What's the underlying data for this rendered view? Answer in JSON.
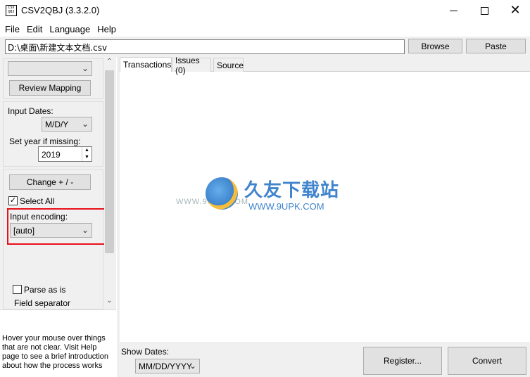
{
  "window": {
    "title": "CSV2QBJ (3.3.2.0)",
    "icon_text": "CSV QBJ",
    "close_glyph": "✕"
  },
  "menu": [
    "File",
    "Edit",
    "Language",
    "Help"
  ],
  "pathbar": {
    "path_value": "D:\\桌面\\新建文本文档.csv",
    "browse_label": "Browse",
    "paste_label": "Paste"
  },
  "left": {
    "mapping_combo_value": "",
    "review_mapping_label": "Review Mapping",
    "input_dates_label": "Input Dates:",
    "date_format_value": "M/D/Y",
    "set_year_label": "Set year if missing:",
    "year_value": "2019",
    "change_sign_label": "Change + / -",
    "select_all_label": "Select All",
    "select_all_checked": true,
    "input_encoding_label": "Input encoding:",
    "encoding_value": "[auto]",
    "parse_as_is_label": "Parse as is",
    "parse_as_is_checked": false,
    "field_separator_label": "Field separator"
  },
  "help_text": "Hover your mouse over things that are not clear. Visit Help page to see a brief introduction about how the process works",
  "tabs": [
    {
      "label": "Transactions",
      "active": true
    },
    {
      "label": "Issues (0)",
      "active": false
    },
    {
      "label": "Source",
      "active": false
    }
  ],
  "watermark": {
    "cn": "久友下载站",
    "url": "WWW.9UPK.COM",
    "url_left": "WWW.9UPK.COM"
  },
  "bottom": {
    "show_dates_label": "Show Dates:",
    "show_dates_value": "MM/DD/YYYY",
    "register_label": "Register...",
    "convert_label": "Convert"
  },
  "colors": {
    "highlight_border": "#e8101a",
    "watermark_blue": "#1e6fc5"
  },
  "icons": [
    "app-icon",
    "minimize-icon",
    "maximize-icon",
    "close-icon",
    "chevron-down-icon",
    "scroll-up-icon",
    "scroll-down-icon",
    "checkmark-icon",
    "spin-up-icon",
    "spin-down-icon"
  ]
}
